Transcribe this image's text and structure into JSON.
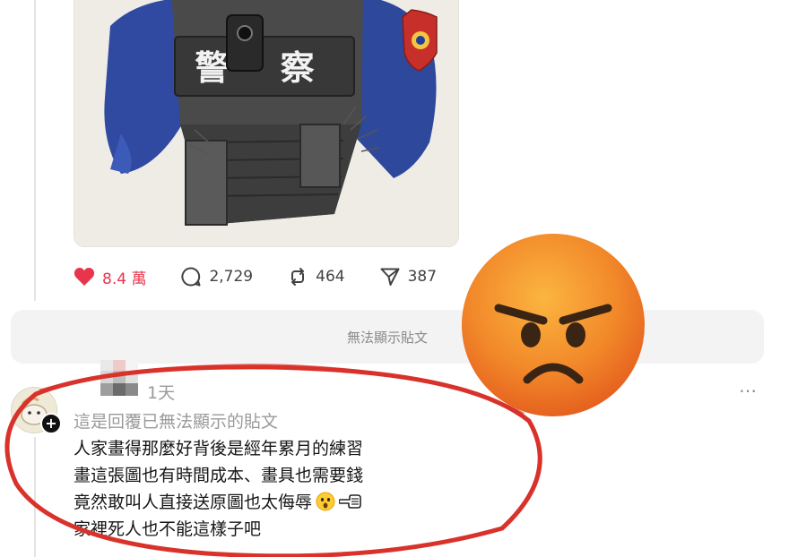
{
  "post": {
    "artwork_text": "警 察",
    "actions": {
      "likes": "8.4 萬",
      "comments": "2,729",
      "reposts": "464",
      "shares": "387"
    }
  },
  "unavailable_notice": "無法顯示貼文",
  "reply": {
    "time": "1天",
    "more_icon": "⋯",
    "context": "這是回覆已無法顯示的貼文",
    "lines": [
      "人家畫得那麼好背後是經年累月的練習",
      "畫這張圖也有時間成本、畫具也需要錢",
      "竟然敢叫人直接送原圖也太侮辱",
      "家裡死人也不能這樣子吧"
    ]
  },
  "colors": {
    "like_red": "#e8354d",
    "highlight_red": "#d8322b",
    "emoji_orange": "#f28a2a"
  },
  "icons": [
    "heart-icon",
    "comment-icon",
    "repost-icon",
    "share-icon",
    "more-icon",
    "angry-face-emoji",
    "astonished-face-emoji",
    "pointing-hand-emoji"
  ]
}
